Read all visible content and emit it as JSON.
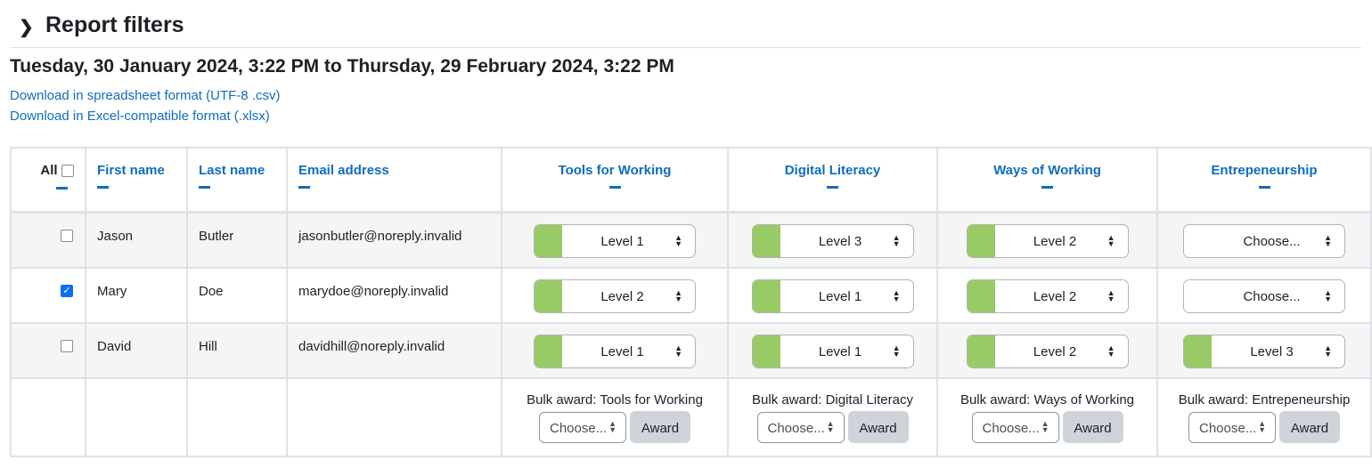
{
  "filters": {
    "title": "Report filters",
    "expand_icon": "chevron-right-icon"
  },
  "date_range": "Tuesday, 30 January 2024, 3:22 PM to Thursday, 29 February 2024, 3:22 PM",
  "downloads": [
    "Download in spreadsheet format (UTF-8 .csv)",
    "Download in Excel-compatible format (.xlsx)"
  ],
  "table": {
    "select_all_label": "All",
    "headers": [
      "First name",
      "Last name",
      "Email address",
      "Tools for Working",
      "Digital Literacy",
      "Ways of Working",
      "Entrepeneurship"
    ],
    "rows": [
      {
        "checked": false,
        "first": "Jason",
        "last": "Butler",
        "email": "jasonbutler@noreply.invalid",
        "levels": [
          "Level 1",
          "Level 3",
          "Level 2",
          "Choose..."
        ]
      },
      {
        "checked": true,
        "first": "Mary",
        "last": "Doe",
        "email": "marydoe@noreply.invalid",
        "levels": [
          "Level 2",
          "Level 1",
          "Level 2",
          "Choose..."
        ]
      },
      {
        "checked": false,
        "first": "David",
        "last": "Hill",
        "email": "davidhill@noreply.invalid",
        "levels": [
          "Level 1",
          "Level 1",
          "Level 2",
          "Level 3"
        ]
      }
    ],
    "level_color": "#98cb65",
    "bulk": {
      "labels": [
        "Bulk award: Tools for Working",
        "Bulk award: Digital Literacy",
        "Bulk award: Ways of Working",
        "Bulk award: Entrepeneurship"
      ],
      "select_value": "Choose...",
      "button_label": "Award"
    }
  }
}
